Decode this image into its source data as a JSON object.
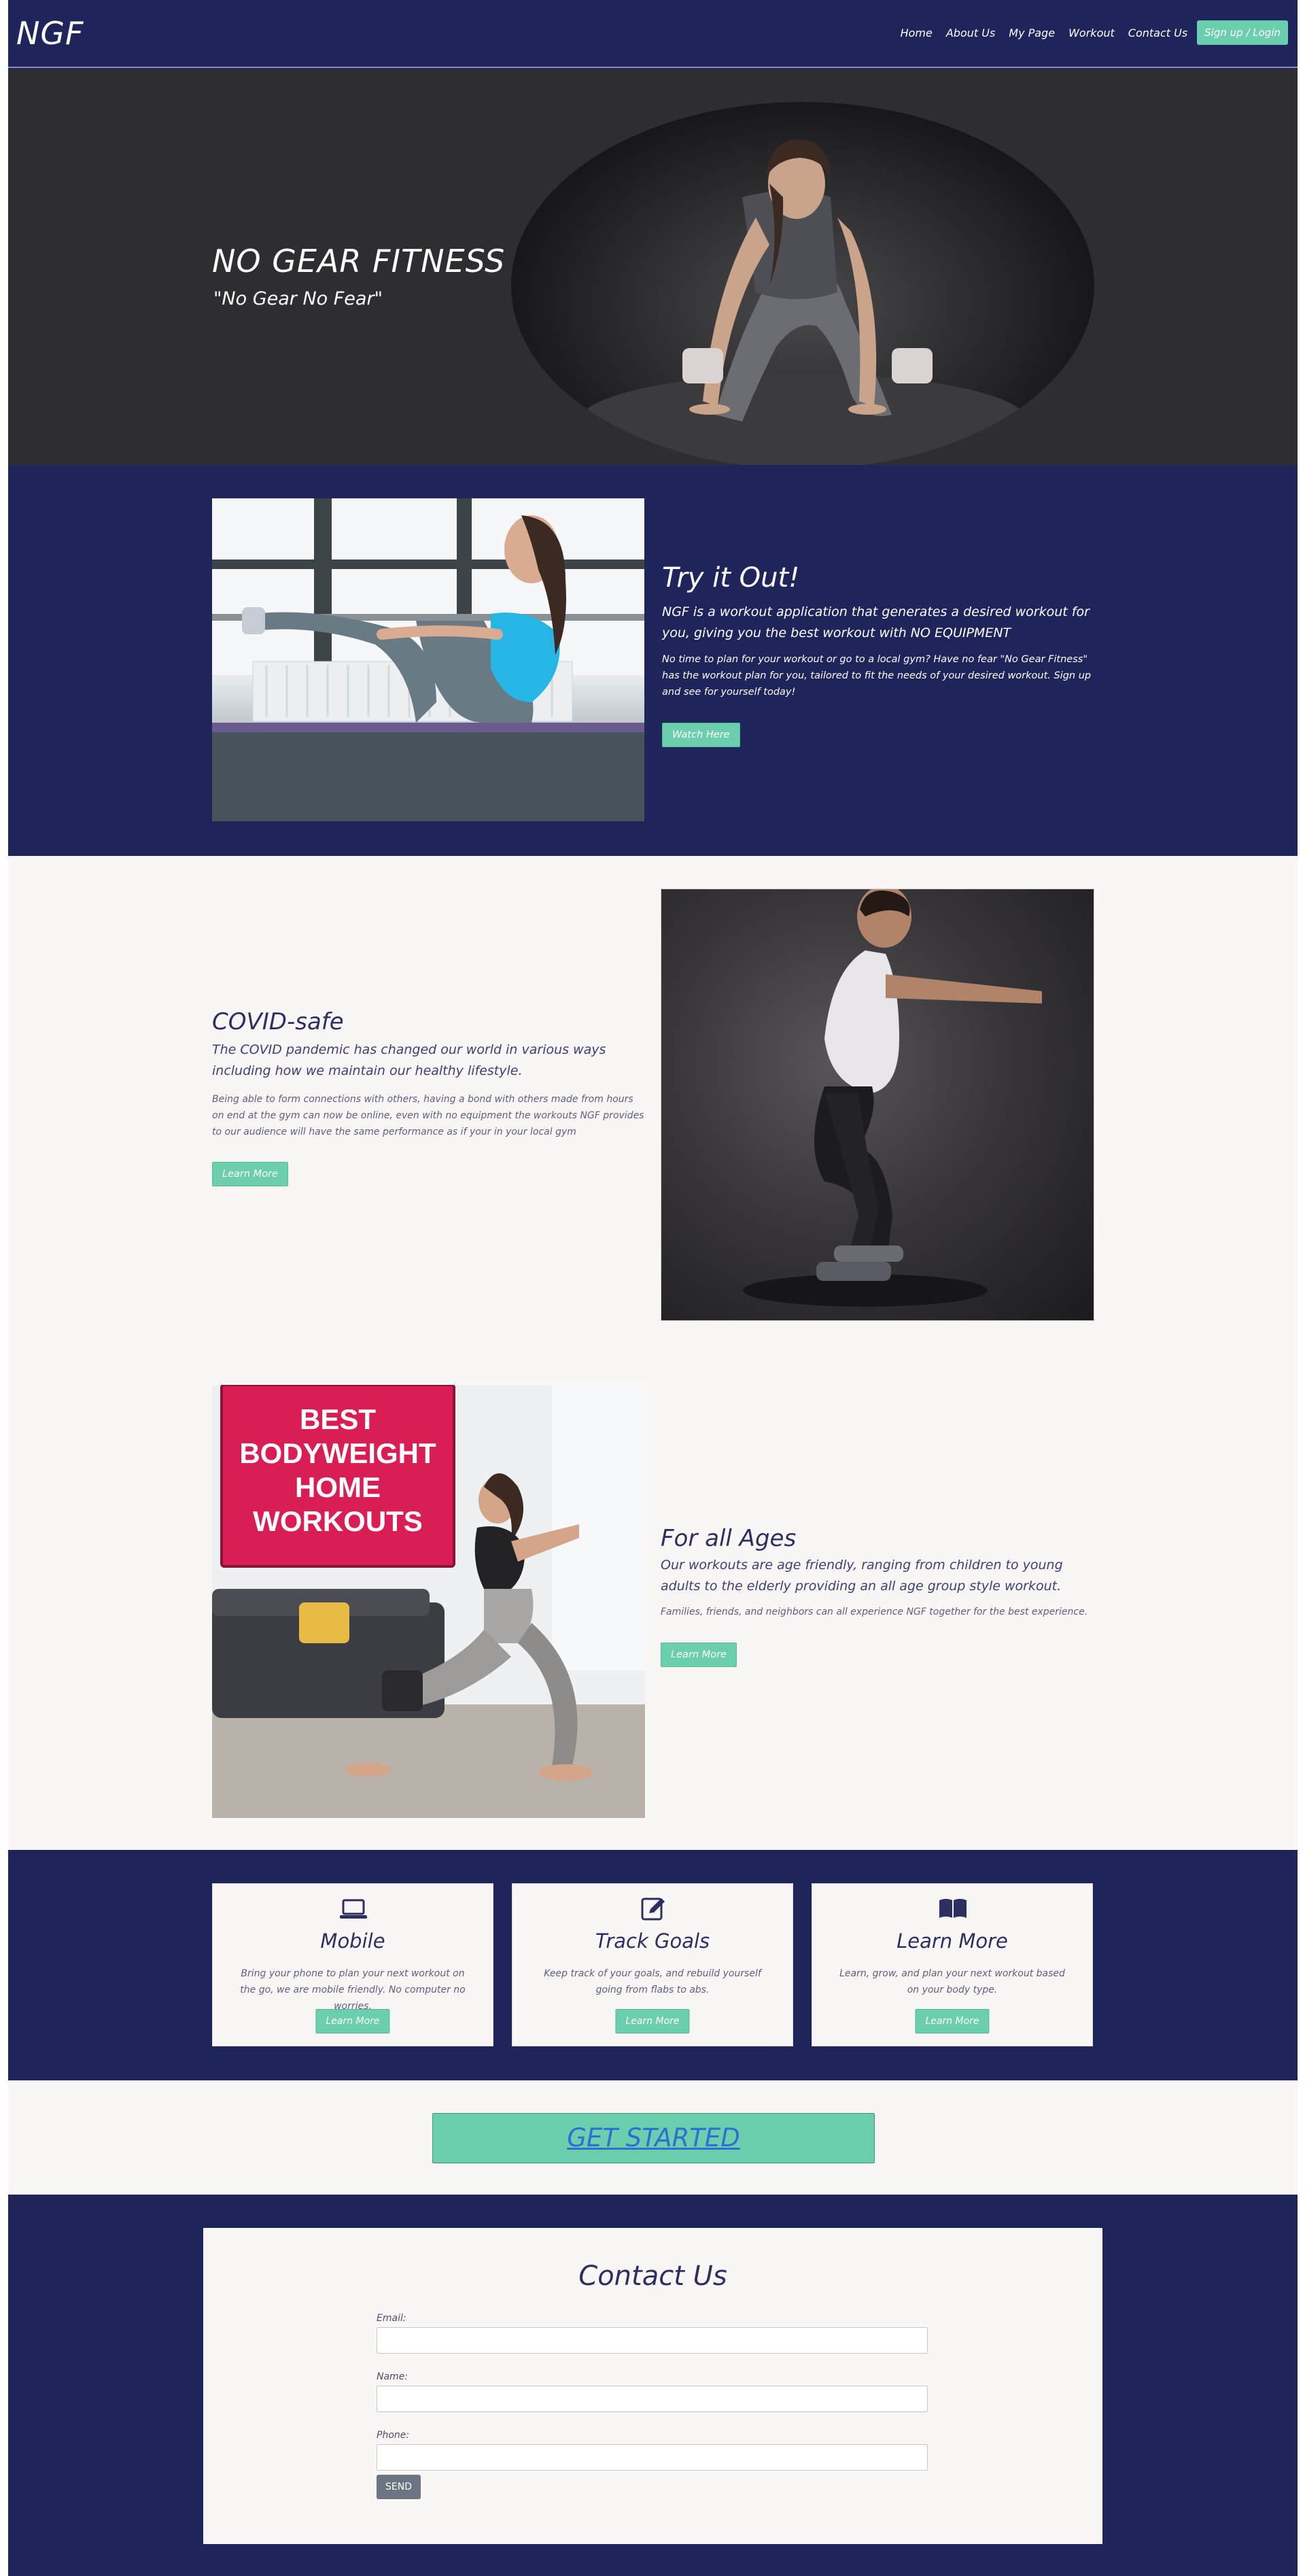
{
  "nav": {
    "brand": "NGF",
    "links": [
      "Home",
      "About Us",
      "My Page",
      "Workout",
      "Contact Us"
    ],
    "signup": "Sign up / Login"
  },
  "hero": {
    "title": "NO GEAR FITNESS",
    "subtitle": "\"No Gear No Fear\""
  },
  "try_it": {
    "title": "Try it Out!",
    "lead": "NGF is a workout application that generates a desired workout for you, giving you the best workout with NO EQUIPMENT",
    "body": "No time to plan for your workout or go to a local gym? Have no fear \"No Gear Fitness\" has the workout plan for you, tailored to fit the needs of your desired workout. Sign up and see for yourself today!",
    "button": "Watch Here"
  },
  "covid": {
    "title": "COVID-safe",
    "lead": "The COVID pandemic has changed our world in various ways including how we maintain our healthy lifestyle.",
    "body": "Being able to form connections with others, having a bond with others made from hours on end at the gym can now be online, even with no equipment the workouts NGF provides to our audience will have the same performance as if your in your local gym",
    "button": "Learn More"
  },
  "ages": {
    "image_banner": [
      "BEST",
      "BODYWEIGHT",
      "HOME",
      "WORKOUTS"
    ],
    "title": "For all Ages",
    "lead": "Our workouts are age friendly, ranging from children to young adults to the elderly providing an all age group style workout.",
    "body": "Families, friends, and neighbors can all experience NGF together for the best experience.",
    "button": "Learn More"
  },
  "features": [
    {
      "icon": "laptop-icon",
      "title": "Mobile",
      "text": "Bring your phone to plan your next workout on the go, we are mobile friendly. No computer no worries.",
      "button": "Learn More"
    },
    {
      "icon": "edit-icon",
      "title": "Track Goals",
      "text": "Keep track of your goals, and rebuild yourself going from flabs to abs.",
      "button": "Learn More"
    },
    {
      "icon": "book-icon",
      "title": "Learn More",
      "text": "Learn, grow, and plan your next workout based on your body type.",
      "button": "Learn More"
    }
  ],
  "get_started": "GET STARTED",
  "contact": {
    "title": "Contact Us",
    "fields": [
      {
        "label": "Email:",
        "value": ""
      },
      {
        "label": "Name:",
        "value": ""
      },
      {
        "label": "Phone:",
        "value": ""
      }
    ],
    "send": "SEND"
  },
  "colors": {
    "navy": "#1f255b",
    "accent_green": "#6bcfae",
    "light_bg": "#faf6f6",
    "hero_bg": "#2e2d32",
    "banner_red": "#d81e55"
  }
}
